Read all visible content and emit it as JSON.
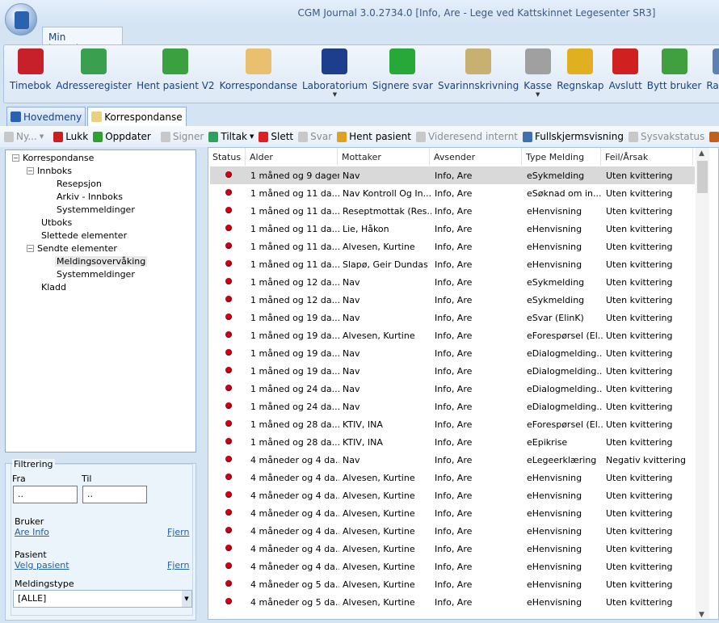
{
  "window": {
    "title": "CGM Journal 3.0.2734.0 [Info, Are - Lege ved Kattskinnet Legesenter SR3]"
  },
  "ribbon": {
    "tab": "Min hovedmeny",
    "buttons": [
      {
        "label": "Timebok",
        "icon": "calendar-icon",
        "color": "#c8202a"
      },
      {
        "label": "Adresseregister",
        "icon": "address-book-icon",
        "color": "#3aa050"
      },
      {
        "label": "Hent pasient V2",
        "icon": "patient-arrow-icon",
        "color": "#3aa040"
      },
      {
        "label": "Korrespondanse",
        "icon": "envelope-icon",
        "color": "#e8c070"
      },
      {
        "label": "Laboratorium",
        "icon": "test-tubes-icon",
        "color": "#1c3e8c",
        "dropdown": true
      },
      {
        "label": "Signere svar",
        "icon": "test-tube-check-icon",
        "color": "#28a838"
      },
      {
        "label": "Svarinnskrivning",
        "icon": "folder-tubes-icon",
        "color": "#c8b070"
      },
      {
        "label": "Kasse",
        "icon": "cash-register-icon",
        "color": "#a0a0a0",
        "dropdown": true
      },
      {
        "label": "Regnskap",
        "icon": "coins-icon",
        "color": "#e0b020"
      },
      {
        "label": "Avslutt",
        "icon": "red-x-icon",
        "color": "#d02020"
      },
      {
        "label": "Bytt bruker",
        "icon": "switch-user-icon",
        "color": "#40a040"
      },
      {
        "label": "Rapport",
        "icon": "report-icon",
        "color": "#6080b0"
      }
    ]
  },
  "doc_tabs": [
    {
      "label": "Hovedmeny",
      "active": false
    },
    {
      "label": "Korrespondanse",
      "active": true
    }
  ],
  "toolbar": [
    {
      "label": "Ny...",
      "icon": "new-icon",
      "disabled": true,
      "dropdown": true
    },
    {
      "label": "Lukk",
      "icon": "close-icon",
      "disabled": false
    },
    {
      "label": "Oppdater",
      "icon": "refresh-icon",
      "disabled": false
    },
    {
      "label": "Signer",
      "icon": "sign-icon",
      "disabled": true
    },
    {
      "label": "Tiltak",
      "icon": "action-icon",
      "disabled": false,
      "dropdown": true
    },
    {
      "label": "Slett",
      "icon": "delete-icon",
      "disabled": false
    },
    {
      "label": "Svar",
      "icon": "reply-icon",
      "disabled": true
    },
    {
      "label": "Hent pasient",
      "icon": "patient-icon",
      "disabled": false
    },
    {
      "label": "Videresend internt",
      "icon": "forward-icon",
      "disabled": true
    },
    {
      "label": "Fullskjermsvisning",
      "icon": "fullscreen-icon",
      "disabled": false
    },
    {
      "label": "Sysvakstatus",
      "icon": "sysvak-icon",
      "disabled": true
    },
    {
      "label": "S",
      "icon": "more-icon",
      "disabled": false
    }
  ],
  "tree": {
    "root": "Korrespondanse",
    "innboks": "Innboks",
    "resepsjon": "Resepsjon",
    "arkiv": "Arkiv - Innboks",
    "sysmeld1": "Systemmeldinger",
    "utboks": "Utboks",
    "slettede": "Slettede elementer",
    "sendte": "Sendte elementer",
    "overvaking": "Meldingsovervåking",
    "sysmeld2": "Systemmeldinger",
    "kladd": "Kladd"
  },
  "filter": {
    "title": "Filtrering",
    "fra_label": "Fra",
    "fra_value": "..",
    "til_label": "Til",
    "til_value": "..",
    "bruker_label": "Bruker",
    "bruker_value": "Are Info",
    "bruker_remove": "Fjern",
    "pasient_label": "Pasient",
    "pasient_value": "Velg pasient",
    "pasient_remove": "Fjern",
    "type_label": "Meldingstype",
    "type_value": "[ALLE]"
  },
  "grid": {
    "columns": [
      "Status",
      "Alder",
      "Mottaker",
      "Avsender",
      "Type Melding",
      "Feil/Årsak"
    ],
    "status_color": "#d0021b",
    "rows": [
      [
        "1 måned og 9 dager",
        "Nav",
        "Info, Are",
        "eSykmelding",
        "Uten kvittering"
      ],
      [
        "1 måned og 11 da...",
        "Nav Kontroll Og In...",
        "Info, Are",
        "eSøknad om in...",
        "Uten kvittering"
      ],
      [
        "1 måned og 11 da...",
        "Reseptmottak (Res...",
        "Info, Are",
        "eHenvisning",
        "Uten kvittering"
      ],
      [
        "1 måned og 11 da...",
        "Lie, Håkon",
        "Info, Are",
        "eHenvisning",
        "Uten kvittering"
      ],
      [
        "1 måned og 11 da...",
        "Alvesen, Kurtine",
        "Info, Are",
        "eHenvisning",
        "Uten kvittering"
      ],
      [
        "1 måned og 11 da...",
        "Slapø, Geir Dundas",
        "Info, Are",
        "eHenvisning",
        "Uten kvittering"
      ],
      [
        "1 måned og 12 da...",
        "Nav",
        "Info, Are",
        "eSykmelding",
        "Uten kvittering"
      ],
      [
        "1 måned og 12 da...",
        "Nav",
        "Info, Are",
        "eSykmelding",
        "Uten kvittering"
      ],
      [
        "1 måned og 19 da...",
        "Nav",
        "Info, Are",
        "eSvar (ElinK)",
        "Uten kvittering"
      ],
      [
        "1 måned og 19 da...",
        "Alvesen, Kurtine",
        "Info, Are",
        "eForespørsel (El...",
        "Uten kvittering"
      ],
      [
        "1 måned og 19 da...",
        "Nav",
        "Info, Are",
        "eDialogmelding...",
        "Uten kvittering"
      ],
      [
        "1 måned og 19 da...",
        "Nav",
        "Info, Are",
        "eDialogmelding...",
        "Uten kvittering"
      ],
      [
        "1 måned og 24 da...",
        "Nav",
        "Info, Are",
        "eDialogmelding...",
        "Uten kvittering"
      ],
      [
        "1 måned og 24 da...",
        "Nav",
        "Info, Are",
        "eDialogmelding...",
        "Uten kvittering"
      ],
      [
        "1 måned og 28 da...",
        "KTIV, INA",
        "Info, Are",
        "eForespørsel (El...",
        "Uten kvittering"
      ],
      [
        "1 måned og 28 da...",
        "KTIV, INA",
        "Info, Are",
        "eEpikrise",
        "Uten kvittering"
      ],
      [
        "4 måneder og 4 da...",
        "Nav",
        "Info, Are",
        "eLegeerklæring",
        "Negativ kvittering"
      ],
      [
        "4 måneder og 4 da...",
        "Alvesen, Kurtine",
        "Info, Are",
        "eHenvisning",
        "Uten kvittering"
      ],
      [
        "4 måneder og 4 da...",
        "Alvesen, Kurtine",
        "Info, Are",
        "eHenvisning",
        "Uten kvittering"
      ],
      [
        "4 måneder og 4 da...",
        "Alvesen, Kurtine",
        "Info, Are",
        "eHenvisning",
        "Uten kvittering"
      ],
      [
        "4 måneder og 4 da...",
        "Alvesen, Kurtine",
        "Info, Are",
        "eHenvisning",
        "Uten kvittering"
      ],
      [
        "4 måneder og 4 da...",
        "Alvesen, Kurtine",
        "Info, Are",
        "eHenvisning",
        "Uten kvittering"
      ],
      [
        "4 måneder og 4 da...",
        "Alvesen, Kurtine",
        "Info, Are",
        "eHenvisning",
        "Uten kvittering"
      ],
      [
        "4 måneder og 5 da...",
        "Alvesen, Kurtine",
        "Info, Are",
        "eHenvisning",
        "Uten kvittering"
      ],
      [
        "4 måneder og 5 da...",
        "Alvesen, Kurtine",
        "Info, Are",
        "eHenvisning",
        "Uten kvittering"
      ]
    ]
  }
}
